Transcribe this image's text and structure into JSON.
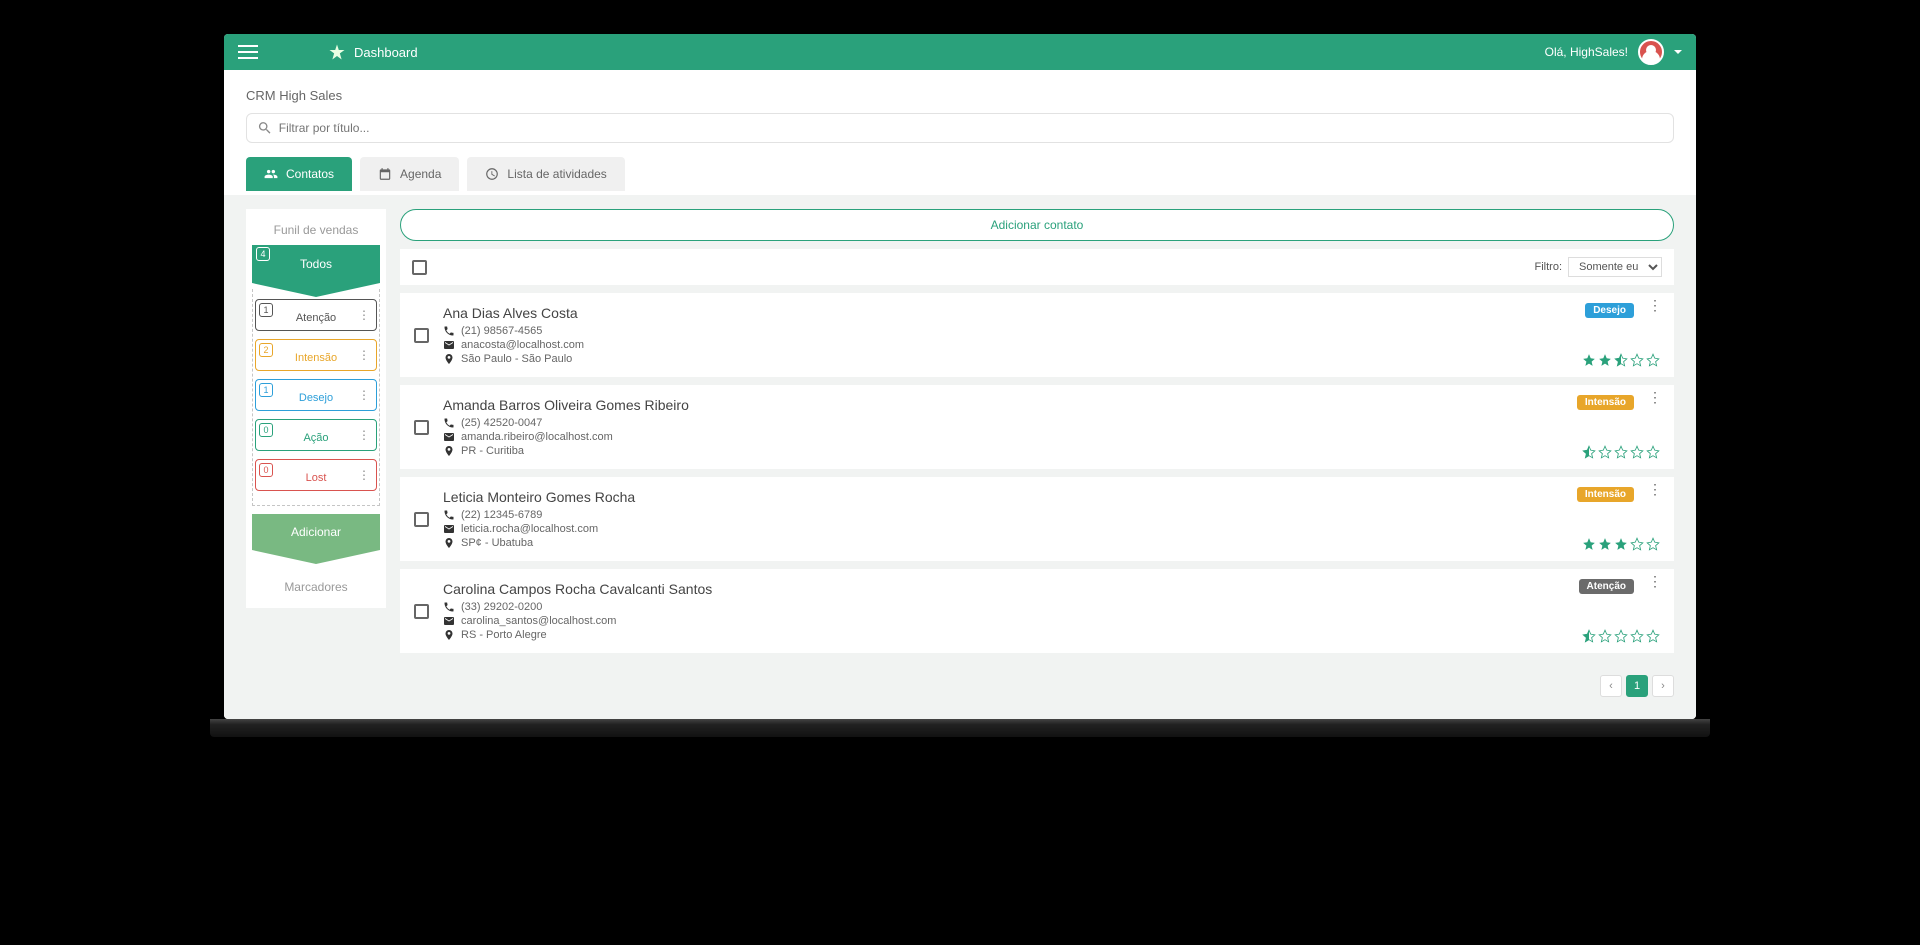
{
  "header": {
    "title": "Dashboard",
    "greeting": "Olá, HighSales!"
  },
  "page": {
    "title": "CRM High Sales",
    "search_placeholder": "Filtrar por título..."
  },
  "tabs": {
    "contacts": "Contatos",
    "agenda": "Agenda",
    "activities": "Lista de atividades"
  },
  "funnel": {
    "title": "Funil de vendas",
    "all_label": "Todos",
    "all_count": "4",
    "stages": [
      {
        "label": "Atenção",
        "count": "1",
        "color": "#555555"
      },
      {
        "label": "Intensão",
        "count": "2",
        "color": "#e8a62a"
      },
      {
        "label": "Desejo",
        "count": "1",
        "color": "#2d9fd9"
      },
      {
        "label": "Ação",
        "count": "0",
        "color": "#2aa17b"
      },
      {
        "label": "Lost",
        "count": "0",
        "color": "#d9534f"
      }
    ],
    "add": "Adicionar",
    "markers": "Marcadores"
  },
  "content": {
    "add_contact": "Adicionar contato",
    "filter_label": "Filtro:",
    "filter_value": "Somente eu"
  },
  "contacts": [
    {
      "name": "Ana Dias Alves Costa",
      "phone": "(21) 98567-4565",
      "email": "anacosta@localhost.com",
      "location": "São Paulo - São Paulo",
      "tag": "Desejo",
      "tag_color": "#2d9fd9",
      "rating": 2.5
    },
    {
      "name": "Amanda Barros Oliveira Gomes Ribeiro",
      "phone": "(25) 42520-0047",
      "email": "amanda.ribeiro@localhost.com",
      "location": "PR - Curitiba",
      "tag": "Intensão",
      "tag_color": "#e8a62a",
      "rating": 0.5
    },
    {
      "name": "Leticia Monteiro Gomes Rocha",
      "phone": "(22) 12345-6789",
      "email": "leticia.rocha@localhost.com",
      "location": "SP¢ - Ubatuba",
      "tag": "Intensão",
      "tag_color": "#e8a62a",
      "rating": 3
    },
    {
      "name": "Carolina Campos Rocha Cavalcanti Santos",
      "phone": "(33) 29202-0200",
      "email": "carolina_santos@localhost.com",
      "location": "RS - Porto Alegre",
      "tag": "Atenção",
      "tag_color": "#6b6b6b",
      "rating": 0.5
    }
  ],
  "pagination": {
    "prev": "‹",
    "page": "1",
    "next": "›"
  }
}
